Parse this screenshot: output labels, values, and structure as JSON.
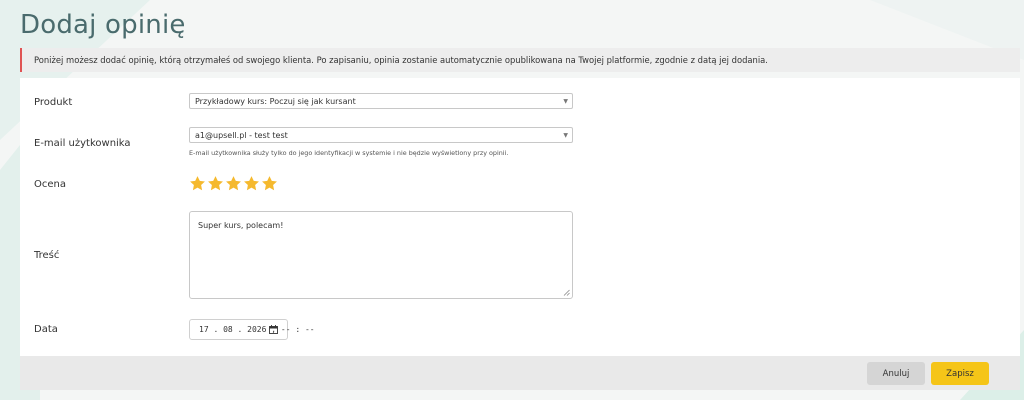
{
  "page": {
    "title": "Dodaj opinię",
    "notice": "Poniżej możesz dodać opinię, którą otrzymałeś od swojego klienta. Po zapisaniu, opinia zostanie automatycznie opublikowana na Twojej platformie, zgodnie z datą jej dodania."
  },
  "form": {
    "product": {
      "label": "Produkt",
      "value": "Przykładowy kurs: Poczuj się jak kursant",
      "icon": "chevron-down-icon"
    },
    "email": {
      "label": "E-mail użytkownika",
      "value": "a1@upsell.pl - test test",
      "help": "E-mail użytkownika służy tylko do jego identyfikacji w systemie i nie będzie wyświetlony przy opinii.",
      "icon": "chevron-down-icon"
    },
    "rating": {
      "label": "Ocena",
      "value": 5,
      "max": 5,
      "color": "#f5b92e",
      "icon": "star-icon"
    },
    "content": {
      "label": "Treść",
      "value": "Super kurs, polecam!"
    },
    "date": {
      "label": "Data",
      "value": "17 . 08 . 2026 ,  -- : --",
      "icon": "calendar-icon"
    }
  },
  "footer": {
    "cancel_label": "Anuluj",
    "save_label": "Zapisz",
    "save_color": "#f5c518"
  }
}
